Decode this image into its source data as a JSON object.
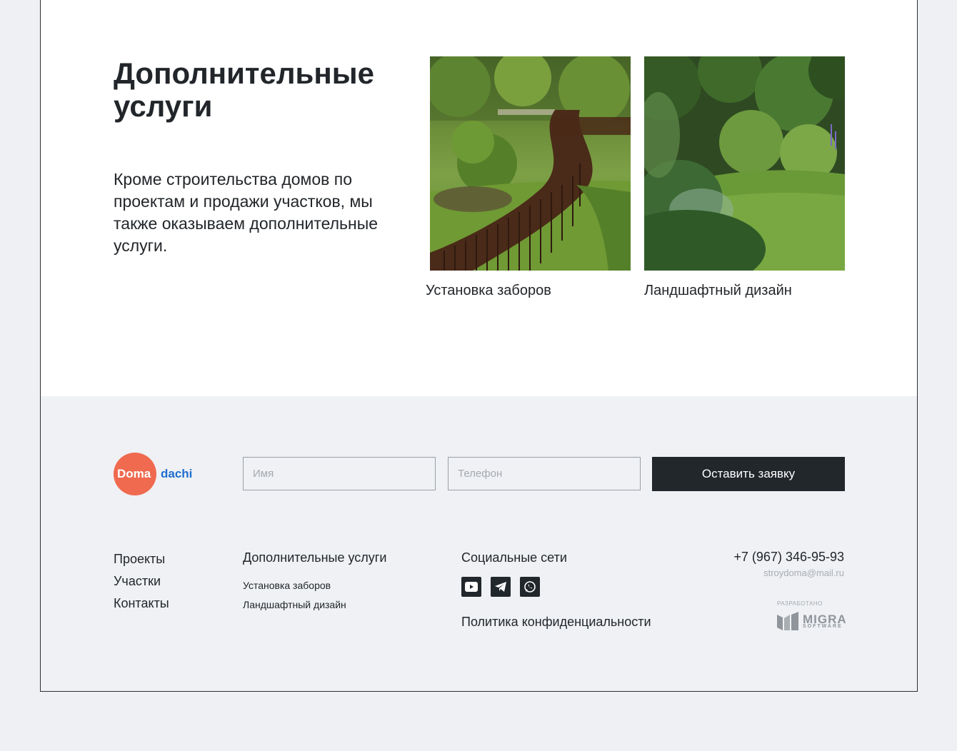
{
  "services": {
    "title": "Дополнительные услуги",
    "description": "Кроме строительства домов по проектам и продажи участков, мы также оказываем дополнительные услуги.",
    "cards": [
      {
        "label": "Установка заборов"
      },
      {
        "label": "Ландшафтный дизайн"
      }
    ]
  },
  "footer": {
    "logo": {
      "part1": "Doma",
      "part2": "dachi"
    },
    "form": {
      "name_placeholder": "Имя",
      "phone_placeholder": "Телефон",
      "submit_label": "Оставить заявку"
    },
    "nav": [
      "Проекты",
      "Участки",
      "Контакты"
    ],
    "services_column": {
      "heading": "Дополнительные услуги",
      "items": [
        "Установка заборов",
        "Ландшафтный дизайн"
      ]
    },
    "social": {
      "heading": "Социальные сети",
      "icons": [
        "youtube-icon",
        "telegram-icon",
        "whatsapp-icon"
      ],
      "policy": "Политика конфиденциальности"
    },
    "contacts": {
      "phone": "+7 (967) 346-95-93",
      "email": "stroydoma@mail.ru"
    },
    "developer": {
      "caption": "РАЗРАБОТАНО",
      "name": "MIGRA",
      "sub": "SOFTWARE"
    }
  },
  "colors": {
    "accent": "#f06a4f",
    "brand_blue": "#1f6fd1",
    "dark": "#22272c",
    "footer_bg": "#eff1f4"
  }
}
